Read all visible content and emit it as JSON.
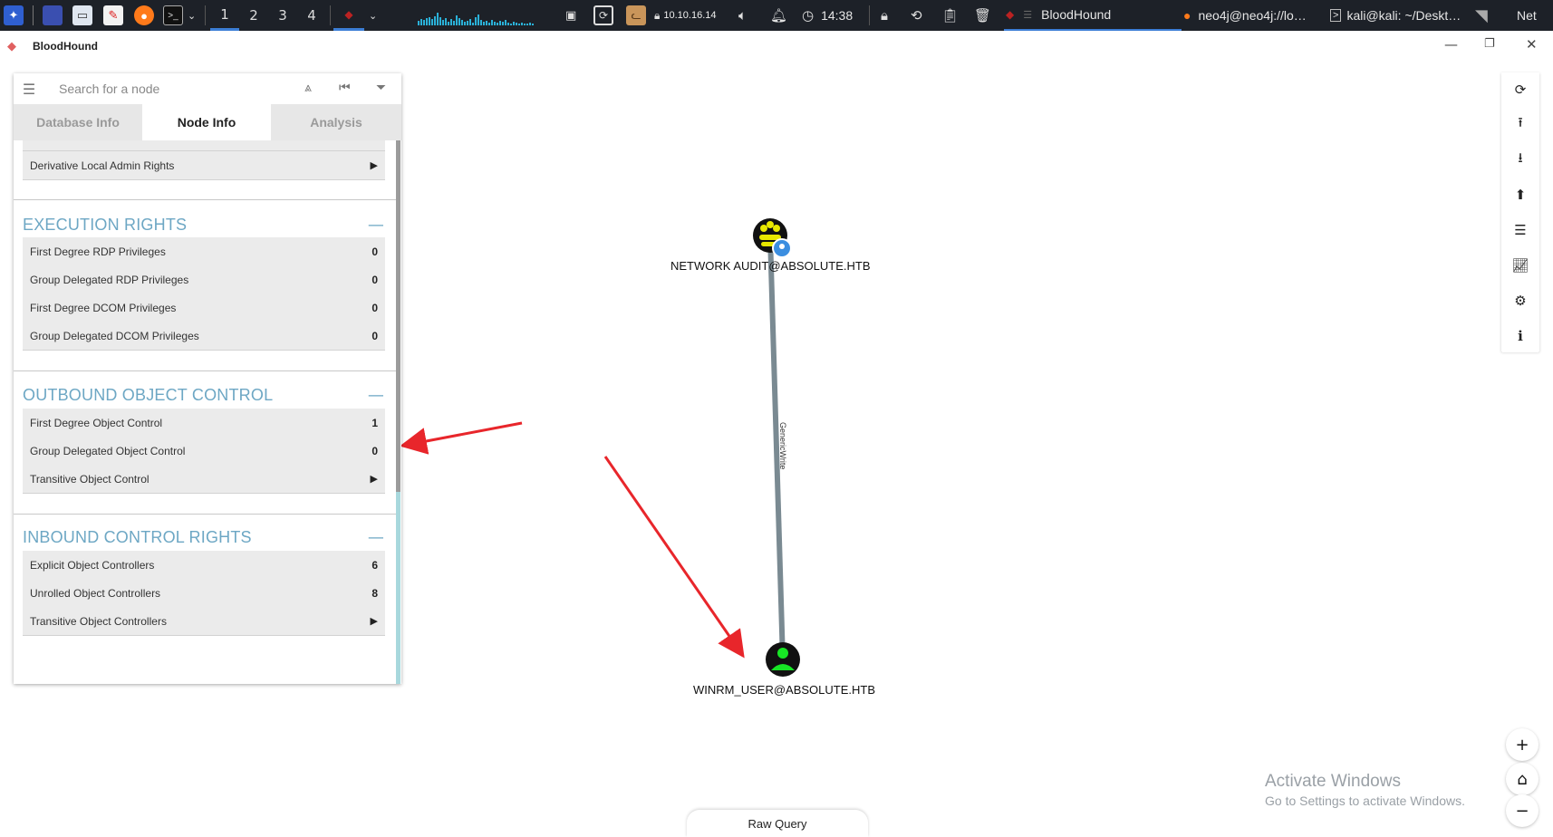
{
  "taskbar": {
    "workspaces": [
      "1",
      "2",
      "3",
      "4"
    ],
    "active_workspace": "1",
    "ip": "10.10.16.14",
    "time": "14:38",
    "windows": [
      {
        "title": "BloodHound",
        "active": true
      },
      {
        "title": "neo4j@neo4j://lo…",
        "active": false
      },
      {
        "title": "kali@kali: ~/Deskt…",
        "active": false
      }
    ],
    "net_label": "Net"
  },
  "app": {
    "title": "BloodHound"
  },
  "search": {
    "placeholder": "Search for a node"
  },
  "tabs": [
    {
      "label": "Database Info",
      "active": false
    },
    {
      "label": "Node Info",
      "active": true
    },
    {
      "label": "Analysis",
      "active": false
    }
  ],
  "node_info": {
    "top_row": {
      "label": "Derivative Local Admin Rights",
      "value": "▶"
    },
    "sections": [
      {
        "title": "EXECUTION RIGHTS",
        "rows": [
          {
            "label": "First Degree RDP Privileges",
            "value": "0"
          },
          {
            "label": "Group Delegated RDP Privileges",
            "value": "0"
          },
          {
            "label": "First Degree DCOM Privileges",
            "value": "0"
          },
          {
            "label": "Group Delegated DCOM Privileges",
            "value": "0"
          }
        ]
      },
      {
        "title": "OUTBOUND OBJECT CONTROL",
        "rows": [
          {
            "label": "First Degree Object Control",
            "value": "1"
          },
          {
            "label": "Group Delegated Object Control",
            "value": "0"
          },
          {
            "label": "Transitive Object Control",
            "value": "▶"
          }
        ]
      },
      {
        "title": "INBOUND CONTROL RIGHTS",
        "rows": [
          {
            "label": "Explicit Object Controllers",
            "value": "6"
          },
          {
            "label": "Unrolled Object Controllers",
            "value": "8"
          },
          {
            "label": "Transitive Object Controllers",
            "value": "▶"
          }
        ]
      }
    ],
    "collapse_symbol": "—"
  },
  "graph": {
    "nodes": [
      {
        "label": "NETWORK AUDIT@ABSOLUTE.HTB",
        "type": "group"
      },
      {
        "label": "WINRM_USER@ABSOLUTE.HTB",
        "type": "user"
      }
    ],
    "edge_label": "GenericWrite",
    "colors": {
      "group_node": "#e8e800",
      "user_node": "#17e625",
      "edge": "#7a8a92",
      "annotation_arrow": "#e8262b",
      "section_title": "#6da7c4"
    }
  },
  "toolbar_icons": [
    "refresh-icon",
    "upload-icon",
    "download-icon",
    "upload-circle-icon",
    "queries-icon",
    "chart-icon",
    "settings-icon",
    "info-icon"
  ],
  "zoom": {
    "in": "+",
    "home": "⌂",
    "out": "−"
  },
  "raw_query": "Raw Query",
  "watermark": {
    "line1": "Activate Windows",
    "line2": "Go to Settings to activate Windows."
  }
}
